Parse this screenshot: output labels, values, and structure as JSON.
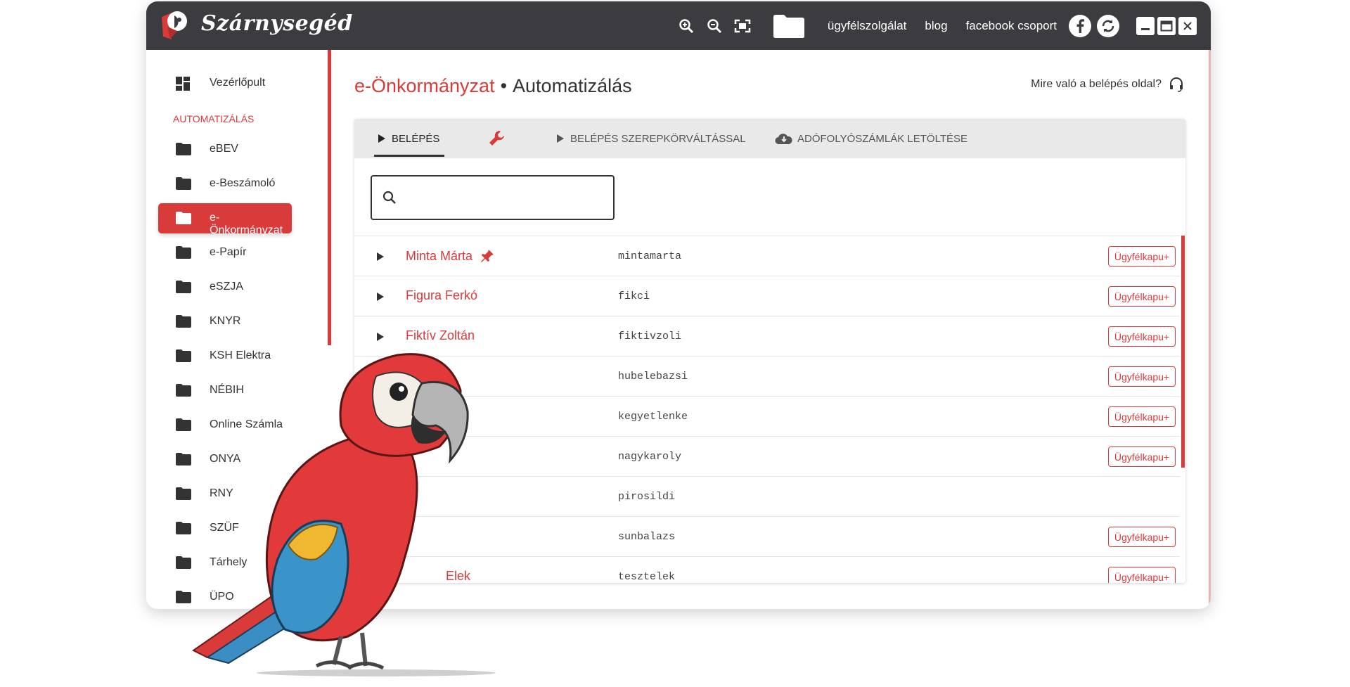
{
  "app": {
    "brand": "Szárnysegéd",
    "toolbar": {
      "links": [
        "ügyfélszolgálat",
        "blog",
        "facebook csoport"
      ],
      "icons": [
        "zoom-in-icon",
        "zoom-out-icon",
        "fit-screen-icon",
        "folder-icon",
        "facebook-icon",
        "refresh-icon",
        "minimize-icon",
        "maximize-icon",
        "close-icon"
      ]
    }
  },
  "sidebar": {
    "dashboard_label": "Vezérlőpult",
    "section_label": "AUTOMATIZÁLÁS",
    "items": [
      {
        "label": "eBEV"
      },
      {
        "label": "e-Beszámoló"
      },
      {
        "label": "e-Önkormányzat",
        "active": true
      },
      {
        "label": "e-Papír"
      },
      {
        "label": "eSZJA"
      },
      {
        "label": "KNYR"
      },
      {
        "label": "KSH Elektra"
      },
      {
        "label": "NÉBIH"
      },
      {
        "label": "Online Számla"
      },
      {
        "label": "ONYA"
      },
      {
        "label": "RNY"
      },
      {
        "label": "SZÜF"
      },
      {
        "label": "Tárhely"
      },
      {
        "label": "ÜPO"
      }
    ]
  },
  "main": {
    "title_primary": "e-Önkormányzat",
    "title_separator": "•",
    "title_secondary": "Automatizálás",
    "help_text": "Mire való a belépés oldal?",
    "tabs": [
      {
        "label": "Belépés",
        "active": true
      },
      {
        "label": ""
      },
      {
        "label": "Belépés szerepkörváltással"
      },
      {
        "label": "Adófolyószámlák letöltése"
      }
    ],
    "search": {
      "value": "",
      "placeholder": ""
    },
    "accounts": [
      {
        "name": "Minta Márta",
        "username": "mintamarta",
        "badge": "Ügyfélkapu+",
        "pinned": true
      },
      {
        "name": "Figura Ferkó",
        "username": "fikci",
        "badge": "Ügyfélkapu+"
      },
      {
        "name": "Fiktív Zoltán",
        "username": "fiktivzoli",
        "badge": "Ügyfélkapu+"
      },
      {
        "name": "",
        "username": "hubelebazsi",
        "badge": "Ügyfélkapu+"
      },
      {
        "name": "",
        "username": "kegyetlenke",
        "badge": "Ügyfélkapu+"
      },
      {
        "name": "",
        "username": "nagykaroly",
        "badge": "Ügyfélkapu+"
      },
      {
        "name": "",
        "username": "pirosildi",
        "badge": ""
      },
      {
        "name": "",
        "username": "sunbalazs",
        "badge": "Ügyfélkapu+"
      },
      {
        "name": "Elek",
        "username": "tesztelek",
        "badge": "Ügyfélkapu+"
      }
    ]
  },
  "colors": {
    "accent": "#d93a3a",
    "titlebar": "#3b3b40"
  }
}
